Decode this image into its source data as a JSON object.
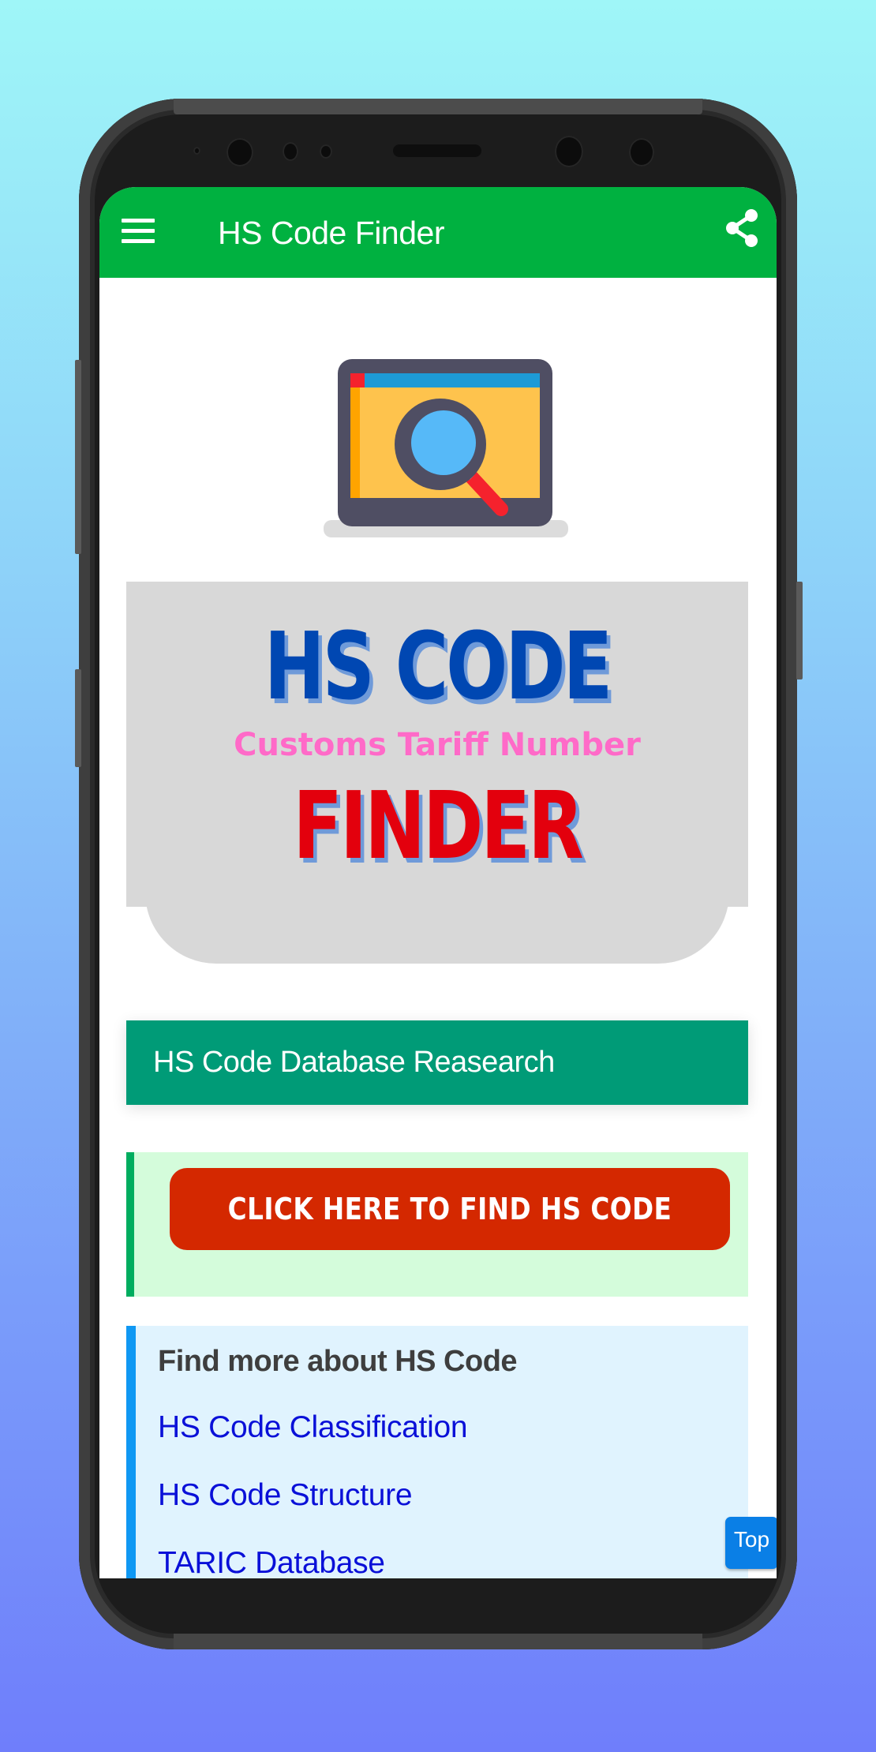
{
  "appbar": {
    "title": "HS Code Finder",
    "menu_icon": "hamburger-menu-icon",
    "share_icon": "share-icon",
    "color": "#00b140"
  },
  "hero": {
    "icon": "laptop-magnifier-icon"
  },
  "banner": {
    "line1": "HS CODE",
    "subtitle": "Customs Tariff Number",
    "line2": "FINDER"
  },
  "research_bar": {
    "label": "HS Code Database Reasearch",
    "color": "#009b77"
  },
  "find_section": {
    "button_label": "CLICK HERE TO FIND HS CODE",
    "button_color": "#d42800"
  },
  "more_section": {
    "title": "Find more about HS Code",
    "links": [
      "HS Code Classification",
      "HS Code Structure",
      "TARIC Database"
    ]
  },
  "top_button": {
    "label": "Top"
  }
}
